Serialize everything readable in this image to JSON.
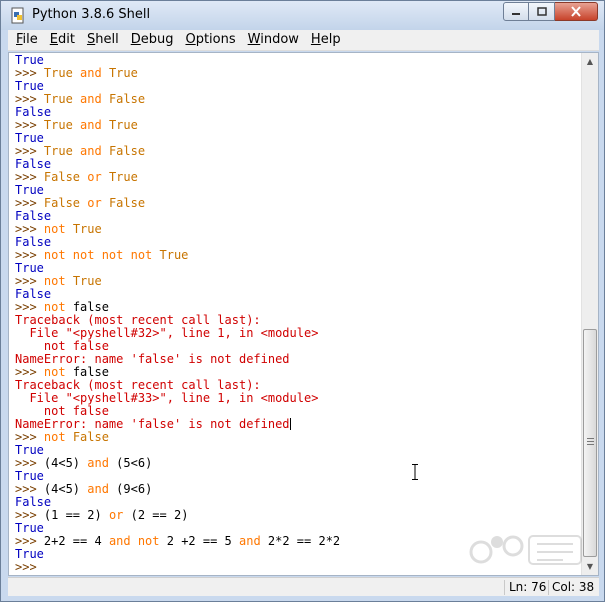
{
  "window": {
    "title": "Python 3.8.6 Shell",
    "controls": {
      "minimize": "minimize",
      "maximize": "maximize",
      "close": "close"
    }
  },
  "menu": {
    "items": [
      {
        "label": "File",
        "mnemonic": "F"
      },
      {
        "label": "Edit",
        "mnemonic": "E"
      },
      {
        "label": "Shell",
        "mnemonic": "S"
      },
      {
        "label": "Debug",
        "mnemonic": "D"
      },
      {
        "label": "Options",
        "mnemonic": "O"
      },
      {
        "label": "Window",
        "mnemonic": "W"
      },
      {
        "label": "Help",
        "mnemonic": "H"
      }
    ]
  },
  "shell": {
    "lines": [
      {
        "parts": [
          {
            "t": "True",
            "c": "out"
          }
        ]
      },
      {
        "parts": [
          {
            "t": ">>> ",
            "c": "prompt"
          },
          {
            "t": "True ",
            "c": "in"
          },
          {
            "t": "and",
            "c": "kw"
          },
          {
            "t": " True",
            "c": "in"
          }
        ]
      },
      {
        "parts": [
          {
            "t": "True",
            "c": "out"
          }
        ]
      },
      {
        "parts": [
          {
            "t": ">>> ",
            "c": "prompt"
          },
          {
            "t": "True ",
            "c": "in"
          },
          {
            "t": "and",
            "c": "kw"
          },
          {
            "t": " False",
            "c": "in"
          }
        ]
      },
      {
        "parts": [
          {
            "t": "False",
            "c": "out"
          }
        ]
      },
      {
        "parts": [
          {
            "t": ">>> ",
            "c": "prompt"
          },
          {
            "t": "True ",
            "c": "in"
          },
          {
            "t": "and",
            "c": "kw"
          },
          {
            "t": " True",
            "c": "in"
          }
        ]
      },
      {
        "parts": [
          {
            "t": "True",
            "c": "out"
          }
        ]
      },
      {
        "parts": [
          {
            "t": ">>> ",
            "c": "prompt"
          },
          {
            "t": "True ",
            "c": "in"
          },
          {
            "t": "and",
            "c": "kw"
          },
          {
            "t": " False",
            "c": "in"
          }
        ]
      },
      {
        "parts": [
          {
            "t": "False",
            "c": "out"
          }
        ]
      },
      {
        "parts": [
          {
            "t": ">>> ",
            "c": "prompt"
          },
          {
            "t": "False ",
            "c": "in"
          },
          {
            "t": "or",
            "c": "kw"
          },
          {
            "t": " True",
            "c": "in"
          }
        ]
      },
      {
        "parts": [
          {
            "t": "True",
            "c": "out"
          }
        ]
      },
      {
        "parts": [
          {
            "t": ">>> ",
            "c": "prompt"
          },
          {
            "t": "False ",
            "c": "in"
          },
          {
            "t": "or",
            "c": "kw"
          },
          {
            "t": " False",
            "c": "in"
          }
        ]
      },
      {
        "parts": [
          {
            "t": "False",
            "c": "out"
          }
        ]
      },
      {
        "parts": [
          {
            "t": ">>> ",
            "c": "prompt"
          },
          {
            "t": "not",
            "c": "kw"
          },
          {
            "t": " True",
            "c": "in"
          }
        ]
      },
      {
        "parts": [
          {
            "t": "False",
            "c": "out"
          }
        ]
      },
      {
        "parts": [
          {
            "t": ">>> ",
            "c": "prompt"
          },
          {
            "t": "not not not not",
            "c": "kw"
          },
          {
            "t": " True",
            "c": "in"
          }
        ]
      },
      {
        "parts": [
          {
            "t": "True",
            "c": "out"
          }
        ]
      },
      {
        "parts": [
          {
            "t": ">>> ",
            "c": "prompt"
          },
          {
            "t": "not",
            "c": "kw"
          },
          {
            "t": " True",
            "c": "in"
          }
        ]
      },
      {
        "parts": [
          {
            "t": "False",
            "c": "out"
          }
        ]
      },
      {
        "parts": [
          {
            "t": ">>> ",
            "c": "prompt"
          },
          {
            "t": "not",
            "c": "kw"
          },
          {
            "t": " false",
            "c": "blk"
          }
        ]
      },
      {
        "parts": [
          {
            "t": "Traceback (most recent call last):",
            "c": "err"
          }
        ]
      },
      {
        "parts": [
          {
            "t": "  File \"<pyshell#32>\", line 1, in <module>",
            "c": "err"
          }
        ]
      },
      {
        "parts": [
          {
            "t": "    not false",
            "c": "err"
          }
        ]
      },
      {
        "parts": [
          {
            "t": "NameError: name 'false' is not defined",
            "c": "err"
          }
        ]
      },
      {
        "parts": [
          {
            "t": ">>> ",
            "c": "prompt"
          },
          {
            "t": "not",
            "c": "kw"
          },
          {
            "t": " false",
            "c": "blk"
          }
        ]
      },
      {
        "parts": [
          {
            "t": "Traceback (most recent call last):",
            "c": "err"
          }
        ]
      },
      {
        "parts": [
          {
            "t": "  File \"<pyshell#33>\", line 1, in <module>",
            "c": "err"
          }
        ]
      },
      {
        "parts": [
          {
            "t": "    not false",
            "c": "err"
          }
        ]
      },
      {
        "parts": [
          {
            "t": "NameError: name 'false' is not defined",
            "c": "err"
          }
        ],
        "cursor": true
      },
      {
        "parts": [
          {
            "t": ">>> ",
            "c": "prompt"
          },
          {
            "t": "not",
            "c": "kw"
          },
          {
            "t": " False",
            "c": "in"
          }
        ]
      },
      {
        "parts": [
          {
            "t": "True",
            "c": "out"
          }
        ]
      },
      {
        "parts": [
          {
            "t": ">>> ",
            "c": "prompt"
          },
          {
            "t": "(4<5) ",
            "c": "blk"
          },
          {
            "t": "and",
            "c": "kw"
          },
          {
            "t": " (5<6)",
            "c": "blk"
          }
        ]
      },
      {
        "parts": [
          {
            "t": "True",
            "c": "out"
          }
        ]
      },
      {
        "parts": [
          {
            "t": ">>> ",
            "c": "prompt"
          },
          {
            "t": "(4<5) ",
            "c": "blk"
          },
          {
            "t": "and",
            "c": "kw"
          },
          {
            "t": " (9<6)",
            "c": "blk"
          }
        ]
      },
      {
        "parts": [
          {
            "t": "False",
            "c": "out"
          }
        ]
      },
      {
        "parts": [
          {
            "t": ">>> ",
            "c": "prompt"
          },
          {
            "t": "(1 == 2) ",
            "c": "blk"
          },
          {
            "t": "or",
            "c": "kw"
          },
          {
            "t": " (2 == 2)",
            "c": "blk"
          }
        ]
      },
      {
        "parts": [
          {
            "t": "True",
            "c": "out"
          }
        ]
      },
      {
        "parts": [
          {
            "t": ">>> ",
            "c": "prompt"
          },
          {
            "t": "2+2 == 4 ",
            "c": "blk"
          },
          {
            "t": "and not",
            "c": "kw"
          },
          {
            "t": " 2 +2 == 5 ",
            "c": "blk"
          },
          {
            "t": "and",
            "c": "kw"
          },
          {
            "t": " 2*2 == 2*2",
            "c": "blk"
          }
        ]
      },
      {
        "parts": [
          {
            "t": "True",
            "c": "out"
          }
        ]
      },
      {
        "parts": [
          {
            "t": ">>> ",
            "c": "prompt"
          }
        ]
      }
    ]
  },
  "status": {
    "line": "Ln: 76",
    "column": "Col: 38"
  },
  "colors": {
    "prompt": "#7a3f00",
    "keyword": "#ff7700",
    "input": "#c77400",
    "output": "#0000c0",
    "error": "#d00000"
  },
  "icons": {
    "app": "python-idle-icon",
    "watermark": "baidu-jingyan-watermark-icon"
  }
}
